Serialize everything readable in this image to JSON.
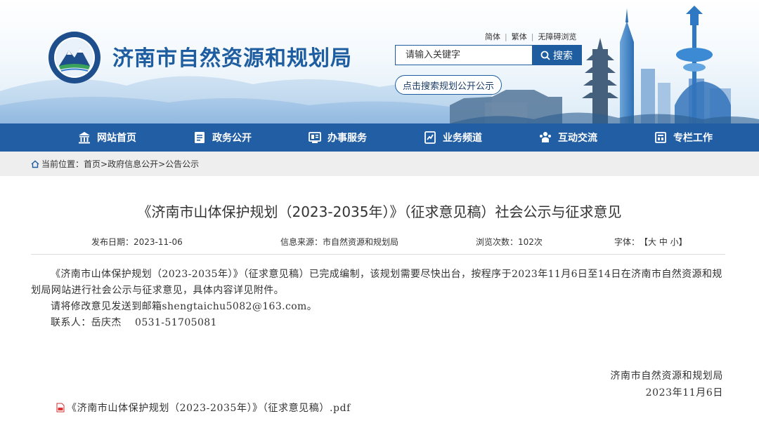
{
  "header": {
    "site_title": "济南市自然资源和规划局",
    "top_links": [
      "简体",
      "繁体",
      "无障碍浏览"
    ],
    "search": {
      "placeholder": "请输入关键字",
      "button_label": "搜索"
    },
    "planning_search_link": "点击搜索规划公开公示"
  },
  "nav": {
    "items": [
      {
        "label": "网站首页",
        "icon": "building-icon"
      },
      {
        "label": "政务公开",
        "icon": "document-icon"
      },
      {
        "label": "办事服务",
        "icon": "service-window-icon"
      },
      {
        "label": "业务频道",
        "icon": "channel-icon"
      },
      {
        "label": "互动交流",
        "icon": "people-icon"
      },
      {
        "label": "专栏工作",
        "icon": "column-icon"
      }
    ]
  },
  "breadcrumb": {
    "prefix": "当前位置：",
    "items": [
      "首页",
      "政府信息公开",
      "公告公示"
    ],
    "separator": ">"
  },
  "article": {
    "title": "《济南市山体保护规划（2023-2035年）》（征求意见稿）社会公示与征求意见",
    "meta": {
      "publish_date": "发布日期：2023-11-06",
      "source": "信息来源：市自然资源和规划局",
      "views": "浏览次数：102次",
      "font_size_label": "字体：",
      "font_size_controls": "【大 中 小】"
    },
    "paragraphs": [
      "《济南市山体保护规划（2023-2035年）》（征求意见稿）已完成编制，该规划需要尽快出台，按程序于2023年11月6日至14日在济南市自然资源和规划局网站进行社会公示与征求意见，具体内容详见附件。",
      "请将修改意见发送到邮箱shengtaichu5082@163.com。",
      "联系人：岳庆杰　 0531-51705081"
    ],
    "signature": {
      "org": "济南市自然资源和规划局",
      "date": "2023年11月6日"
    },
    "attachment": "《济南市山体保护规划（2023-2035年）》（征求意见稿）.pdf"
  },
  "colors": {
    "primary": "#215ea4",
    "title_blue": "#1e5da0",
    "breadcrumb_bg": "#eeeeee"
  }
}
